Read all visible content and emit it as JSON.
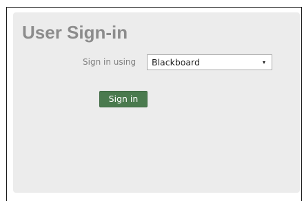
{
  "page": {
    "title": "User Sign-in"
  },
  "form": {
    "sign_in_label": "Sign in using",
    "method_select": {
      "selected": "Blackboard",
      "icon": "chevron-down-icon"
    },
    "submit_label": "Sign in"
  },
  "colors": {
    "panel_background": "#ececec",
    "title_text": "#8c8c8c",
    "button_background": "#4a7a4e",
    "button_text": "#ffffff"
  }
}
